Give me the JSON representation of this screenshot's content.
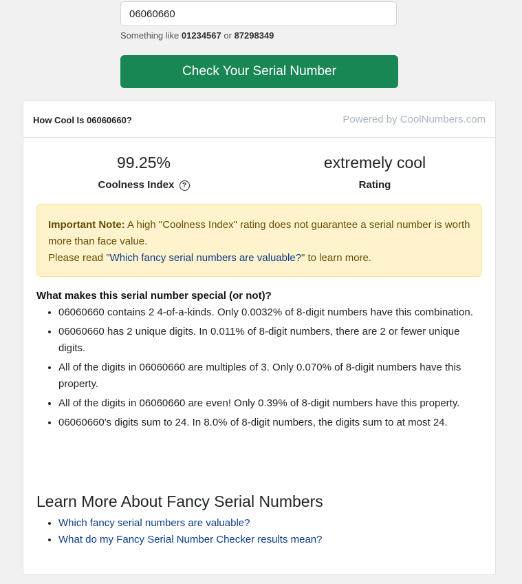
{
  "form": {
    "serial_value": "06060660",
    "hint_prefix": "Something like",
    "example1": "01234567",
    "hint_or": "or",
    "example2": "87298349",
    "button_label": "Check Your Serial Number"
  },
  "card": {
    "title": "How Cool Is 06060660?",
    "powered_by": "Powered by CoolNumbers.com",
    "coolness_value": "99.25%",
    "coolness_label": "Coolness Index",
    "help_icon": "?",
    "rating_value": "extremely cool",
    "rating_label": "Rating"
  },
  "note": {
    "bold": "Important Note:",
    "text": "A high \"Coolness Index\" rating does not guarantee a serial number is worth more than face value.",
    "read_prefix": "Please read \"",
    "link": "Which fancy serial numbers are valuable?",
    "read_suffix": "\" to learn more."
  },
  "special": {
    "heading": "What makes this serial number special (or not)?",
    "items": [
      "06060660 contains 2 4-of-a-kinds. Only 0.0032% of 8-digit numbers have this combination.",
      "06060660 has 2 unique digits. In 0.011% of 8-digit numbers, there are 2 or fewer unique digits.",
      "All of the digits in 06060660 are multiples of 3. Only 0.070% of 8-digit numbers have this property.",
      "All of the digits in 06060660 are even! Only 0.39% of 8-digit numbers have this property.",
      "06060660's digits sum to 24. In 8.0% of 8-digit numbers, the digits sum to at most 24."
    ]
  },
  "learn": {
    "heading": "Learn More About Fancy Serial Numbers",
    "links": [
      "Which fancy serial numbers are valuable?",
      "What do my Fancy Serial Number Checker results mean?"
    ]
  }
}
